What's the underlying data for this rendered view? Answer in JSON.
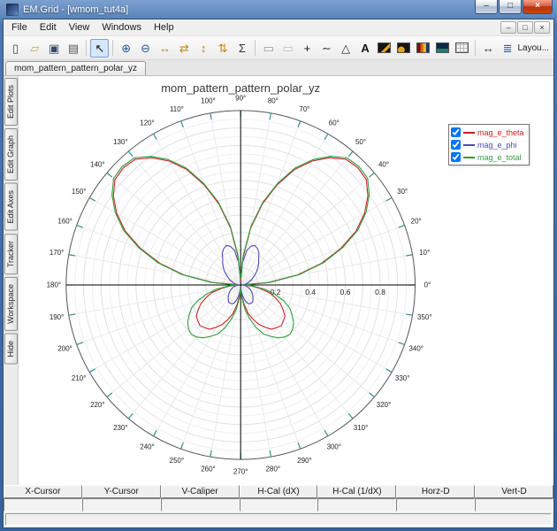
{
  "window": {
    "title": "EM.Grid - [wmom_tut4a]",
    "caption_buttons": {
      "minimize": "–",
      "maximize": "□",
      "close": "×"
    }
  },
  "menubar": {
    "items": [
      "File",
      "Edit",
      "View",
      "Windows",
      "Help"
    ],
    "mdi_buttons": [
      {
        "name": "mdi-minimize-button",
        "glyph": "–"
      },
      {
        "name": "mdi-restore-button",
        "glyph": "□"
      },
      {
        "name": "mdi-close-button",
        "glyph": "×"
      }
    ]
  },
  "toolbar": {
    "layout_label": "Layou...",
    "buttons": [
      {
        "name": "new-document",
        "glyph": "▯",
        "color": "#444"
      },
      {
        "name": "open-folder",
        "glyph": "▱",
        "color": "#c9a43c"
      },
      {
        "name": "save-file",
        "glyph": "▣",
        "color": "#3a4a66"
      },
      {
        "name": "print",
        "glyph": "▤",
        "color": "#555"
      },
      {
        "sep": true
      },
      {
        "name": "pointer-tool",
        "glyph": "↖",
        "color": "#111",
        "selected": true
      },
      {
        "sep": true
      },
      {
        "name": "zoom-in",
        "glyph": "⊕",
        "color": "#2a5a9a"
      },
      {
        "name": "zoom-out",
        "glyph": "⊖",
        "color": "#2a5a9a"
      },
      {
        "name": "fit-horizontal",
        "glyph": "↔",
        "color": "#c8860a"
      },
      {
        "name": "fit-horizontal-limits",
        "glyph": "⇄",
        "color": "#c8860a"
      },
      {
        "name": "fit-vertical",
        "glyph": "↕",
        "color": "#c8860a"
      },
      {
        "name": "fit-vertical-limits",
        "glyph": "⇅",
        "color": "#c8860a"
      },
      {
        "name": "autoscale-sum",
        "glyph": "Σ",
        "color": "#333"
      },
      {
        "sep": true
      },
      {
        "name": "region-select",
        "glyph": "▭",
        "color": "#999"
      },
      {
        "name": "region-zoom",
        "glyph": "▭",
        "color": "#c0c0c0"
      },
      {
        "name": "add-marker",
        "glyph": "+",
        "color": "#111"
      },
      {
        "name": "spline-tool",
        "glyph": "∼",
        "color": "#333"
      },
      {
        "name": "delta-tool",
        "glyph": "△",
        "color": "#333"
      },
      {
        "name": "text-tool",
        "glyph": "A",
        "color": "#111",
        "bold": true
      },
      {
        "name": "image-palette",
        "swatch": "sw1"
      },
      {
        "name": "image-trace",
        "swatch": "sw2"
      },
      {
        "name": "image-contour",
        "swatch": "sw3"
      },
      {
        "name": "image-surface",
        "swatch": "sw4"
      },
      {
        "name": "grid-toggle",
        "swatch": "sw5"
      },
      {
        "sep": true
      },
      {
        "name": "pan-horizontal",
        "glyph": "↔",
        "color": "#333"
      },
      {
        "name": "layout",
        "glyph": "≣",
        "color": "#2a5ad0",
        "push_right": true
      }
    ]
  },
  "tabs": [
    {
      "label": "mom_pattern_pattern_polar_yz",
      "active": true
    }
  ],
  "sidebar": {
    "tabs": [
      "Edit Plots",
      "Edit Graph",
      "Edit Axes",
      "Tracker",
      "Workspace",
      "Hide"
    ]
  },
  "legend": {
    "entries": [
      {
        "label": "mag_e_theta",
        "color": "#cc2020",
        "checked": true
      },
      {
        "label": "mag_e_phi",
        "color": "#4a4ab8",
        "checked": true
      },
      {
        "label": "mag_e_total",
        "color": "#2e9e3e",
        "checked": true
      }
    ]
  },
  "readout": {
    "headers": [
      "X-Cursor",
      "Y-Cursor",
      "V-Caliper",
      "H-Cal (dX)",
      "H-Cal (1/dX)",
      "Horz-D",
      "Vert-D"
    ],
    "values": [
      "",
      "",
      "",
      "",
      "",
      "",
      ""
    ]
  },
  "chart_data": {
    "type": "line",
    "polar": true,
    "title": "mom_pattern_pattern_polar_yz",
    "angle_unit": "deg",
    "angle_tick_step": 10,
    "r_axis_ticks": [
      0.2,
      0.4,
      0.6,
      0.8
    ],
    "r_max": 1.0,
    "r_grid_step": 0.05,
    "tick_color": "#2f8f8f",
    "legend_position": "top-right",
    "angles_deg": [
      0,
      5,
      10,
      15,
      20,
      25,
      30,
      35,
      40,
      45,
      50,
      55,
      60,
      65,
      70,
      75,
      80,
      85,
      90,
      95,
      100,
      105,
      110,
      115,
      120,
      125,
      130,
      135,
      140,
      145,
      150,
      155,
      160,
      165,
      170,
      175,
      180,
      185,
      190,
      195,
      200,
      205,
      210,
      215,
      220,
      225,
      230,
      235,
      240,
      245,
      250,
      255,
      260,
      265,
      270,
      275,
      280,
      285,
      290,
      295,
      300,
      305,
      310,
      315,
      320,
      325,
      330,
      335,
      340,
      345,
      350,
      355
    ],
    "series": [
      {
        "name": "mag_e_theta",
        "color": "#cc2020",
        "r": [
          0.01,
          0.16,
          0.33,
          0.48,
          0.61,
          0.73,
          0.82,
          0.89,
          0.94,
          0.95,
          0.94,
          0.89,
          0.82,
          0.73,
          0.61,
          0.48,
          0.33,
          0.16,
          0.02,
          0.16,
          0.33,
          0.48,
          0.61,
          0.73,
          0.82,
          0.89,
          0.94,
          0.95,
          0.94,
          0.89,
          0.82,
          0.73,
          0.61,
          0.48,
          0.33,
          0.16,
          0.01,
          0.06,
          0.11,
          0.17,
          0.21,
          0.25,
          0.28,
          0.31,
          0.32,
          0.33,
          0.32,
          0.31,
          0.28,
          0.25,
          0.21,
          0.17,
          0.11,
          0.06,
          0.01,
          0.06,
          0.11,
          0.17,
          0.21,
          0.25,
          0.28,
          0.31,
          0.32,
          0.33,
          0.32,
          0.31,
          0.28,
          0.25,
          0.21,
          0.17,
          0.11,
          0.06
        ]
      },
      {
        "name": "mag_e_phi",
        "color": "#4a4ab8",
        "r": [
          0.01,
          0.02,
          0.03,
          0.04,
          0.05,
          0.07,
          0.08,
          0.1,
          0.12,
          0.14,
          0.16,
          0.18,
          0.21,
          0.23,
          0.24,
          0.23,
          0.2,
          0.13,
          0.03,
          0.13,
          0.2,
          0.23,
          0.24,
          0.23,
          0.21,
          0.18,
          0.16,
          0.14,
          0.12,
          0.1,
          0.08,
          0.07,
          0.05,
          0.04,
          0.03,
          0.02,
          0.01,
          0.02,
          0.03,
          0.04,
          0.05,
          0.06,
          0.07,
          0.08,
          0.09,
          0.1,
          0.11,
          0.12,
          0.12,
          0.12,
          0.11,
          0.09,
          0.06,
          0.03,
          0.01,
          0.03,
          0.06,
          0.09,
          0.11,
          0.12,
          0.12,
          0.12,
          0.11,
          0.1,
          0.09,
          0.08,
          0.07,
          0.06,
          0.05,
          0.04,
          0.03,
          0.02
        ]
      },
      {
        "name": "mag_e_total",
        "color": "#2e9e3e",
        "r": [
          0.02,
          0.17,
          0.34,
          0.49,
          0.62,
          0.74,
          0.83,
          0.9,
          0.95,
          0.96,
          0.95,
          0.9,
          0.83,
          0.74,
          0.62,
          0.49,
          0.34,
          0.17,
          0.03,
          0.17,
          0.34,
          0.49,
          0.62,
          0.74,
          0.83,
          0.9,
          0.95,
          0.96,
          0.95,
          0.9,
          0.83,
          0.74,
          0.62,
          0.49,
          0.34,
          0.17,
          0.02,
          0.07,
          0.14,
          0.2,
          0.26,
          0.31,
          0.34,
          0.37,
          0.39,
          0.4,
          0.39,
          0.37,
          0.34,
          0.31,
          0.26,
          0.2,
          0.14,
          0.07,
          0.02,
          0.07,
          0.14,
          0.2,
          0.26,
          0.31,
          0.34,
          0.37,
          0.39,
          0.4,
          0.39,
          0.37,
          0.34,
          0.31,
          0.26,
          0.2,
          0.14,
          0.07
        ]
      }
    ]
  }
}
